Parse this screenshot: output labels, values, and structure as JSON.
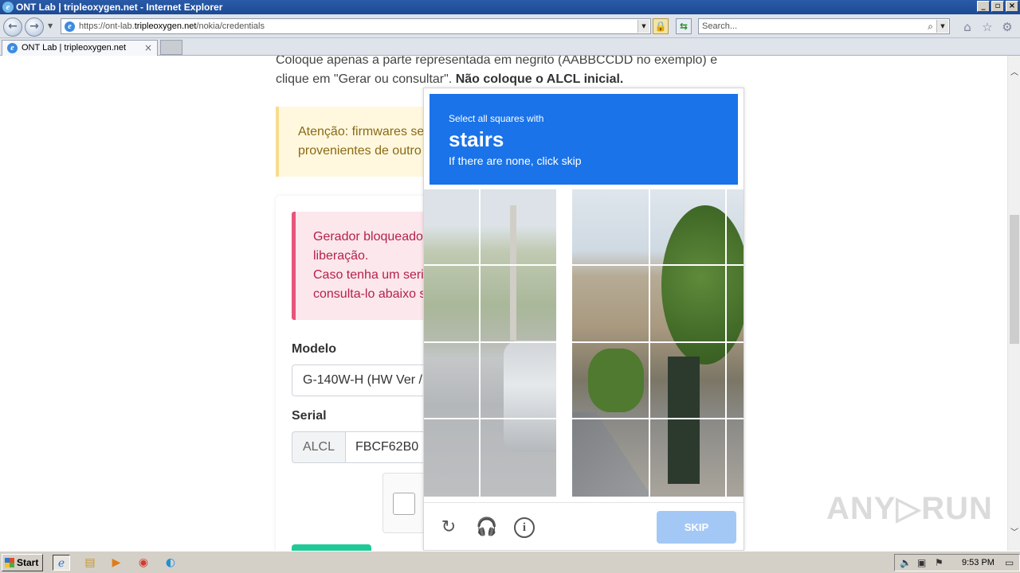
{
  "window": {
    "title": "ONT Lab | tripleoxygen.net - Internet Explorer",
    "controls": {
      "minimize": "_",
      "maximize": "▫",
      "close": "×"
    }
  },
  "navbar": {
    "back_icon": "back-arrow-icon",
    "forward_icon": "forward-arrow-icon",
    "url_prefix": "https://ont-lab.",
    "url_domain": "tripleoxygen.net",
    "url_path": "/nokia/credentials",
    "search_placeholder": "Search..."
  },
  "tabs": [
    {
      "label": "ONT Lab | tripleoxygen.net"
    }
  ],
  "page": {
    "intro_text": "Coloque apenas a parte representada em negrito (AABBCCDD no exemplo) e clique em \"Gerar ou consultar\". ",
    "intro_bold": "Não coloque o ALCL inicial.",
    "warning_line1": "Atenção: firmwares ser",
    "warning_line2": "provenientes de outro",
    "error_line1": "Gerador bloqueado",
    "error_line2": "liberação.",
    "error_line3": "Caso tenha um seria",
    "error_line4": "consulta-lo abaixo s",
    "model_label": "Modelo",
    "model_value": "G-140W-H (HW Ver /",
    "serial_label": "Serial",
    "serial_prefix": "ALCL",
    "serial_value": "FBCF62B0"
  },
  "captcha": {
    "prompt_line1": "Select all squares with",
    "prompt_object": "stairs",
    "prompt_line3": "If there are none, click skip",
    "skip_label": "SKIP",
    "footer_icons": [
      "refresh-icon",
      "audio-headphones-icon",
      "info-icon"
    ]
  },
  "watermark": "ANY▷RUN",
  "taskbar": {
    "start_label": "Start",
    "clock": "9:53 PM",
    "pinned": [
      "internet-explorer-icon",
      "folder-icon",
      "media-player-icon",
      "chrome-icon",
      "edge-icon"
    ]
  }
}
